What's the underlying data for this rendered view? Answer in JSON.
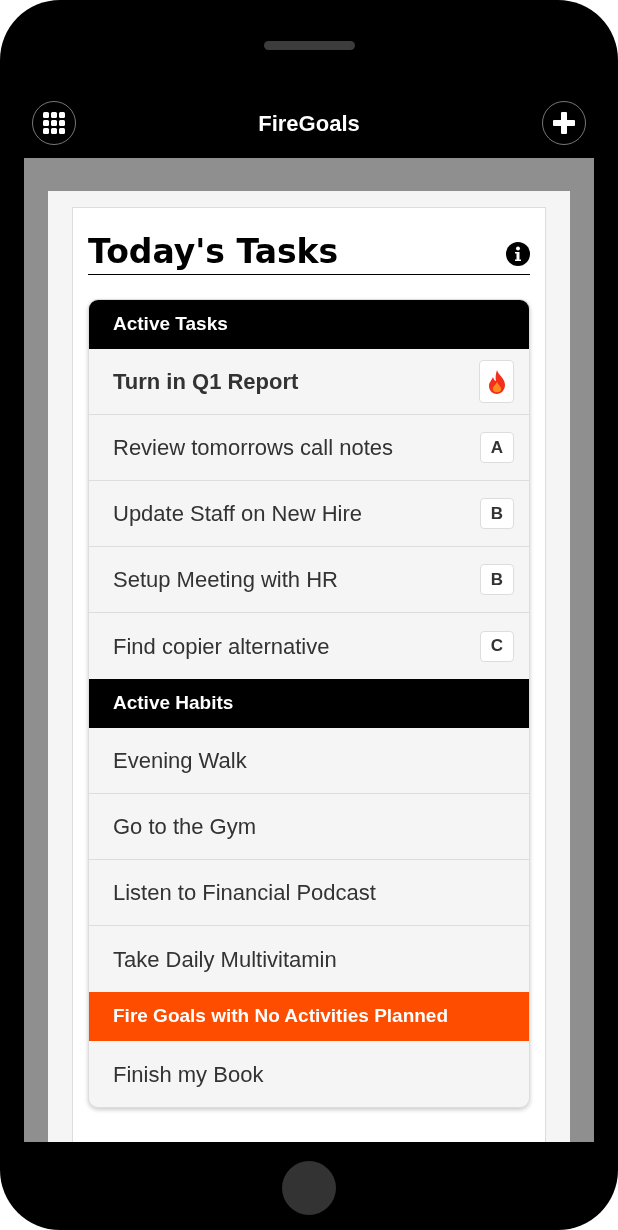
{
  "app_bar": {
    "title": "FireGoals"
  },
  "page": {
    "title": "Today's Tasks"
  },
  "sections": [
    {
      "title": "Active Tasks",
      "color": "#000000",
      "items": [
        {
          "label": "Turn in Q1 Report",
          "urgent": true,
          "badge": {
            "kind": "fire"
          }
        },
        {
          "label": "Review tomorrows call notes",
          "urgent": false,
          "badge": {
            "kind": "letter",
            "text": "A"
          }
        },
        {
          "label": "Update Staff on New Hire",
          "urgent": false,
          "badge": {
            "kind": "letter",
            "text": "B"
          }
        },
        {
          "label": "Setup Meeting with HR",
          "urgent": false,
          "badge": {
            "kind": "letter",
            "text": "B"
          }
        },
        {
          "label": "Find copier alternative",
          "urgent": false,
          "badge": {
            "kind": "letter",
            "text": "C"
          }
        }
      ]
    },
    {
      "title": "Active Habits",
      "color": "#000000",
      "items": [
        {
          "label": "Evening Walk",
          "urgent": false
        },
        {
          "label": "Go to the Gym",
          "urgent": false
        },
        {
          "label": "Listen to Financial Podcast",
          "urgent": false
        },
        {
          "label": "Take Daily Multivitamin",
          "urgent": false
        }
      ]
    },
    {
      "title": "Fire Goals with No Activities Planned",
      "color": "#ff4d00",
      "items": [
        {
          "label": "Finish my Book",
          "urgent": false
        }
      ]
    }
  ]
}
